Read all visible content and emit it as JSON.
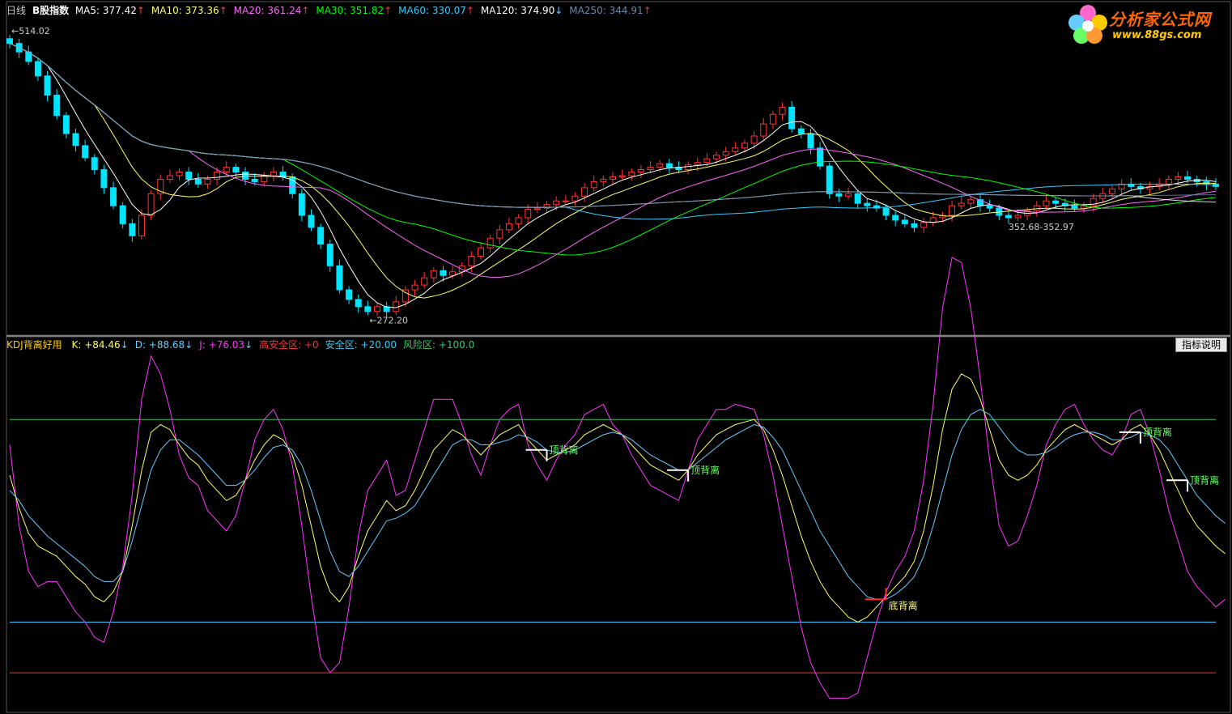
{
  "header": {
    "period": "日线",
    "name": "B股指数",
    "ma": [
      {
        "label": "MA5: 377.42",
        "arrow": "↑",
        "color": "#ffffff"
      },
      {
        "label": "MA10: 373.36",
        "arrow": "↑",
        "color": "#ffff66"
      },
      {
        "label": "MA20: 361.24",
        "arrow": "↑",
        "color": "#ff66ff"
      },
      {
        "label": "MA30: 351.82",
        "arrow": "↑",
        "color": "#00ff00"
      },
      {
        "label": "MA60: 330.07",
        "arrow": "↑",
        "color": "#33ccff"
      },
      {
        "label": "MA120: 374.90",
        "arrow": "↓",
        "color": "#ffffff"
      },
      {
        "label": "MA250: 344.91",
        "arrow": "↑",
        "color": "#6688aa"
      }
    ]
  },
  "price_labels": {
    "high": "514.02",
    "low": "272.20",
    "range": "352.68-352.97"
  },
  "kdj_header": {
    "title": "KDJ背离好用",
    "items": [
      {
        "label": "K: +84.46",
        "arrow": "↓",
        "color": "#ffff66"
      },
      {
        "label": "D: +88.68",
        "arrow": "↓",
        "color": "#66ccff"
      },
      {
        "label": "J: +76.03",
        "arrow": "↓",
        "color": "#ff33ff"
      },
      {
        "label": "高安全区: +0",
        "arrow": "",
        "color": "#ff3333"
      },
      {
        "label": "安全区: +20.00",
        "arrow": "",
        "color": "#33ccff"
      },
      {
        "label": "风险区: +100.0",
        "arrow": "",
        "color": "#33cc66"
      }
    ]
  },
  "indicator_button": "指标说明",
  "logo": {
    "title": "分析家公式网",
    "url": "www.88gs.com"
  },
  "signals": [
    {
      "text": "顶背离",
      "color": "#66ff66"
    },
    {
      "text": "顶背离",
      "color": "#66ff66"
    },
    {
      "text": "底背离",
      "color": "#ffff66"
    },
    {
      "text": "顶背离",
      "color": "#66ff66"
    },
    {
      "text": "顶背离",
      "color": "#66ff66"
    }
  ],
  "chart_data": {
    "type": "candlestick",
    "n": 140,
    "price_range": [
      265,
      525
    ],
    "close": [
      505,
      498,
      490,
      478,
      462,
      445,
      430,
      420,
      410,
      400,
      385,
      370,
      355,
      345,
      362,
      380,
      392,
      395,
      398,
      392,
      388,
      392,
      398,
      402,
      398,
      392,
      390,
      395,
      398,
      394,
      380,
      362,
      352,
      338,
      320,
      300,
      292,
      286,
      282,
      286,
      282,
      290,
      300,
      304,
      310,
      316,
      312,
      315,
      320,
      328,
      335,
      343,
      350,
      355,
      360,
      367,
      368,
      371,
      374,
      374,
      378,
      385,
      390,
      392,
      394,
      395,
      398,
      400,
      402,
      405,
      402,
      400,
      404,
      406,
      409,
      412,
      415,
      418,
      422,
      428,
      438,
      446,
      452,
      434,
      430,
      418,
      403,
      380,
      378,
      380,
      372,
      370,
      368,
      362,
      358,
      355,
      352,
      356,
      360,
      362,
      370,
      372,
      375,
      370,
      368,
      362,
      360,
      362,
      366,
      370,
      374,
      372,
      370,
      368,
      370,
      376,
      380,
      384,
      388,
      386,
      384,
      386,
      388,
      392,
      394,
      392,
      390,
      388,
      386
    ],
    "kdj": {
      "k": [
        78,
        65,
        55,
        50,
        48,
        46,
        42,
        38,
        35,
        30,
        28,
        32,
        40,
        58,
        80,
        95,
        98,
        96,
        90,
        85,
        82,
        76,
        72,
        68,
        70,
        76,
        84,
        90,
        94,
        92,
        86,
        74,
        58,
        42,
        32,
        28,
        34,
        46,
        56,
        62,
        68,
        64,
        66,
        72,
        80,
        88,
        92,
        96,
        94,
        90,
        86,
        90,
        94,
        96,
        98,
        92,
        88,
        84,
        86,
        88,
        90,
        94,
        96,
        98,
        96,
        94,
        90,
        86,
        82,
        80,
        78,
        76,
        80,
        86,
        90,
        94,
        96,
        98,
        99,
        100,
        96,
        88,
        78,
        66,
        54,
        44,
        36,
        30,
        26,
        22,
        20,
        22,
        26,
        30,
        34,
        38,
        44,
        56,
        74,
        96,
        112,
        118,
        116,
        108,
        96,
        84,
        78,
        76,
        78,
        82,
        88,
        92,
        96,
        98,
        96,
        94,
        92,
        90,
        92,
        96,
        98,
        94,
        88,
        80,
        72,
        64,
        58,
        54,
        50,
        47
      ],
      "d": [
        72,
        68,
        62,
        58,
        54,
        51,
        48,
        45,
        42,
        38,
        36,
        36,
        40,
        52,
        66,
        80,
        88,
        92,
        92,
        89,
        86,
        82,
        78,
        74,
        74,
        76,
        80,
        85,
        89,
        90,
        88,
        82,
        72,
        60,
        48,
        40,
        38,
        42,
        48,
        54,
        60,
        61,
        63,
        66,
        72,
        78,
        84,
        90,
        92,
        92,
        90,
        90,
        91,
        92,
        94,
        93,
        91,
        88,
        87,
        87,
        88,
        90,
        92,
        94,
        95,
        94,
        92,
        89,
        86,
        84,
        82,
        80,
        80,
        83,
        86,
        89,
        92,
        94,
        96,
        98,
        97,
        93,
        88,
        80,
        72,
        64,
        56,
        50,
        44,
        38,
        34,
        30,
        29,
        29,
        31,
        34,
        38,
        46,
        58,
        72,
        86,
        96,
        102,
        104,
        102,
        97,
        92,
        88,
        86,
        86,
        87,
        89,
        92,
        94,
        95,
        95,
        94,
        92,
        92,
        93,
        95,
        94,
        92,
        88,
        82,
        76,
        70,
        66,
        62,
        59
      ],
      "j": [
        90,
        58,
        40,
        34,
        36,
        36,
        30,
        24,
        20,
        14,
        12,
        24,
        42,
        70,
        108,
        125,
        118,
        104,
        86,
        77,
        74,
        64,
        60,
        56,
        62,
        76,
        92,
        100,
        104,
        96,
        82,
        58,
        30,
        6,
        0,
        4,
        26,
        54,
        72,
        78,
        84,
        70,
        72,
        84,
        96,
        108,
        108,
        108,
        98,
        86,
        78,
        90,
        100,
        104,
        106,
        90,
        82,
        76,
        84,
        90,
        94,
        102,
        104,
        106,
        98,
        94,
        86,
        80,
        74,
        72,
        70,
        68,
        80,
        92,
        98,
        104,
        104,
        106,
        105,
        104,
        94,
        78,
        58,
        38,
        18,
        4,
        -4,
        -10,
        -10,
        -10,
        -8,
        6,
        20,
        32,
        40,
        46,
        56,
        76,
        106,
        144,
        164,
        162,
        144,
        116,
        84,
        58,
        50,
        52,
        62,
        74,
        90,
        98,
        104,
        106,
        98,
        92,
        88,
        86,
        92,
        102,
        104,
        94,
        80,
        64,
        52,
        40,
        34,
        30,
        26,
        29
      ]
    },
    "kdj_levels": {
      "risk": 100,
      "safe": 20,
      "high_safe": 0
    },
    "kdj_range": [
      -15,
      125
    ]
  }
}
